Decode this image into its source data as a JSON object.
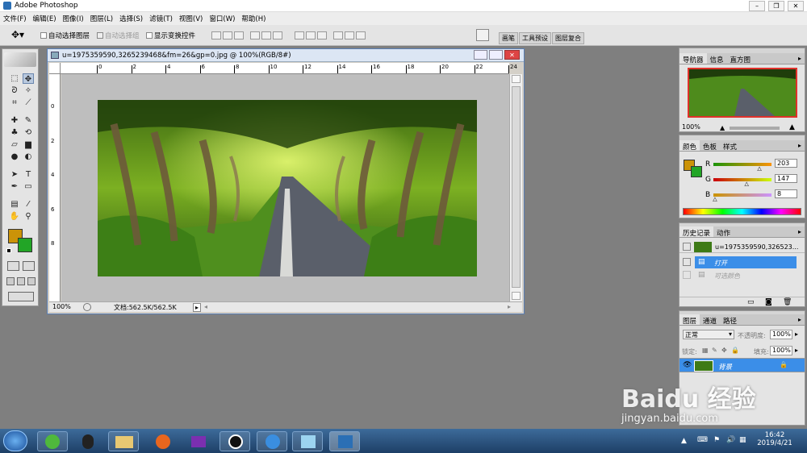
{
  "app": {
    "title": "Adobe Photoshop"
  },
  "menu": [
    "文件(F)",
    "编辑(E)",
    "图像(I)",
    "图层(L)",
    "选择(S)",
    "滤镜(T)",
    "视图(V)",
    "窗口(W)",
    "帮助(H)"
  ],
  "options": {
    "auto_select_layer": "自动选择图层",
    "auto_select_group": "自动选择组",
    "show_transform": "显示变换控件"
  },
  "well_tabs": [
    "画笔",
    "工具预设",
    "图层复合"
  ],
  "document": {
    "title": "u=1975359590,3265239468&fm=26&gp=0.jpg @ 100%(RGB/8#)",
    "zoom": "100%",
    "doc_size": "文档:562.5K/562.5K",
    "ruler_top": [
      "0",
      "2",
      "4",
      "6",
      "8",
      "10",
      "12",
      "14",
      "16",
      "18",
      "20",
      "22",
      "24"
    ],
    "ruler_left": [
      "0",
      "2",
      "4",
      "6",
      "8"
    ]
  },
  "navigator": {
    "tabs": [
      "导航器",
      "信息",
      "直方图"
    ],
    "zoom": "100%"
  },
  "color": {
    "tabs": [
      "颜色",
      "色板",
      "样式"
    ],
    "r_label": "R",
    "g_label": "G",
    "b_label": "B",
    "r": "203",
    "g": "147",
    "b": "8",
    "r_value": 203,
    "g_value": 147,
    "b_value": 8,
    "foreground": "#cb9308",
    "background": "#22a526"
  },
  "history": {
    "tabs": [
      "历史记录",
      "动作"
    ],
    "snapshot": "u=1975359590,326523...",
    "items": [
      "打开",
      "可选颜色"
    ]
  },
  "layers": {
    "tabs": [
      "图层",
      "通道",
      "路径"
    ],
    "blend_mode": "正常",
    "opacity_label": "不透明度:",
    "opacity": "100%",
    "lock_label": "锁定:",
    "fill_label": "填充:",
    "fill": "100%",
    "layer_name": "背景"
  },
  "taskbar": {
    "time": "16:42",
    "date": "2019/4/21"
  },
  "watermark": {
    "logo": "Baidu 经验",
    "url": "jingyan.baidu.com"
  }
}
